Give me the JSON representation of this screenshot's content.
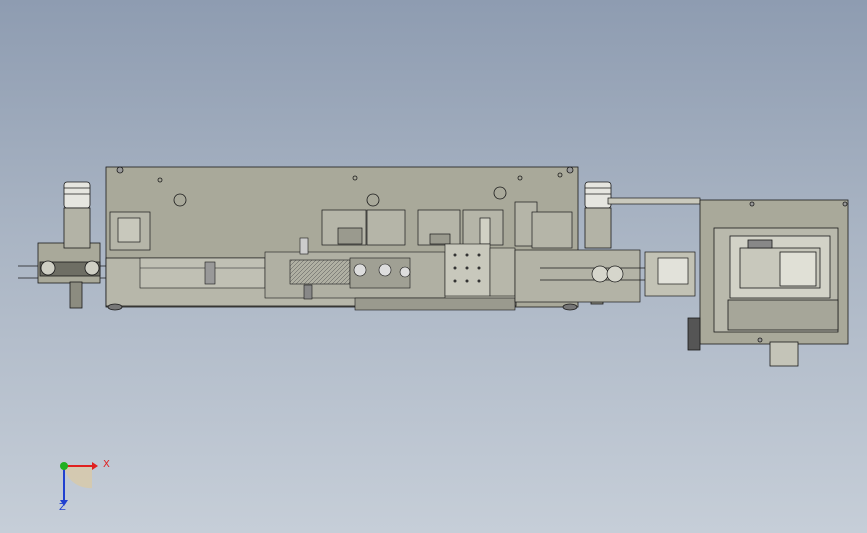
{
  "viewport": {
    "background_top": "#8e9cb1",
    "background_bottom": "#c6ced8",
    "model_fill": "#a9a99a",
    "model_stroke": "#1a1a1a"
  },
  "triad": {
    "x_label": "X",
    "z_label": "Z",
    "x_color": "#e02020",
    "y_color": "#20b020",
    "z_color": "#2040d0"
  }
}
